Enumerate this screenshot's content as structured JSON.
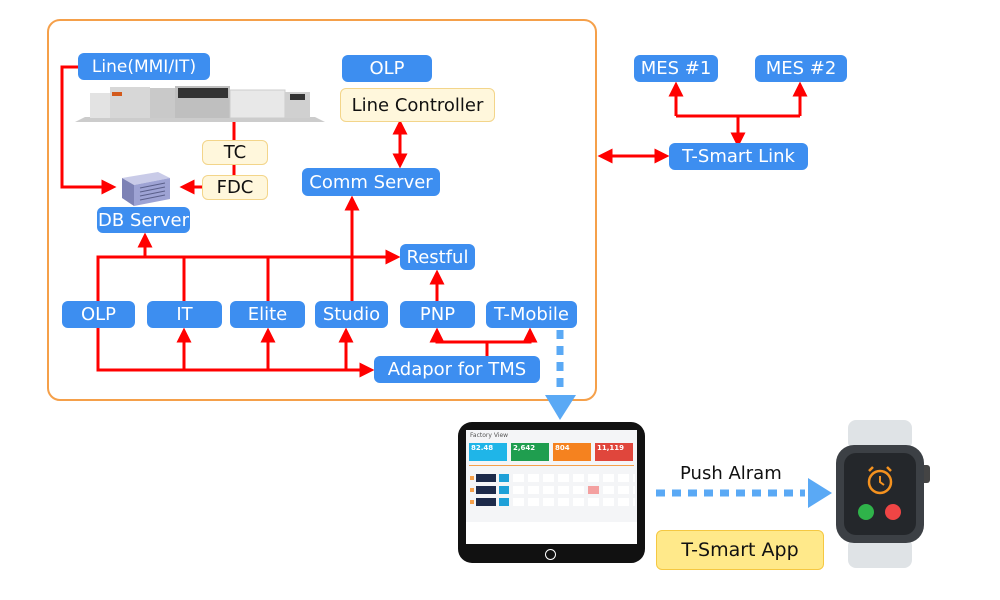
{
  "frame": {
    "color": "#f5a04a"
  },
  "line": {
    "label": "Line(MMI/IT)"
  },
  "olp_top": "OLP",
  "line_controller": "Line Controller",
  "tc": "TC",
  "fdc": "FDC",
  "db_server": "DB Server",
  "comm_server": "Comm Server",
  "restful": "Restful",
  "bottom": [
    "OLP",
    "IT",
    "Elite",
    "Studio",
    "PNP",
    "T-Mobile"
  ],
  "adaptor": "Adapor for TMS",
  "mes": [
    "MES #1",
    "MES #2"
  ],
  "tsmart_link": "T-Smart Link",
  "push": "Push Alram",
  "tsmart_app": "T-Smart App",
  "tablet": {
    "title": "Factory View",
    "kpis": [
      "82.48",
      "2,642",
      "804",
      "11,119"
    ],
    "kpi_colors": [
      "#1fb5e8",
      "#1f9e4f",
      "#f5821f",
      "#e0463c"
    ]
  },
  "colors": {
    "accent_blue": "#3d8ef0",
    "arrow_red": "#ff0000",
    "dotted_blue": "#5aa9f5"
  }
}
